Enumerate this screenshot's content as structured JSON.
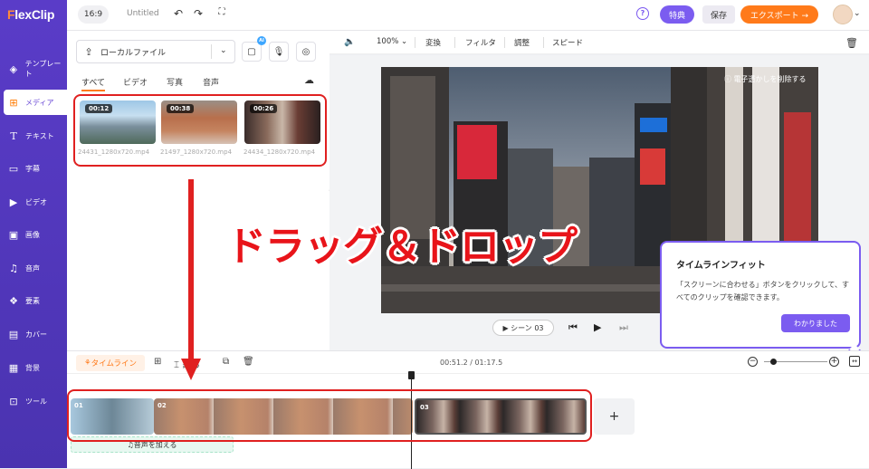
{
  "app": {
    "logo": "FlexClip",
    "doc_title": "Untitled",
    "ratio": "16:9"
  },
  "topbar": {
    "special_label": "特典",
    "save_label": "保存",
    "export_label": "エクスポート →"
  },
  "sidebar": {
    "items": [
      {
        "label": "テンプレート",
        "icon": "layers-icon"
      },
      {
        "label": "メディア",
        "icon": "media-icon"
      },
      {
        "label": "テキスト",
        "icon": "text-icon"
      },
      {
        "label": "字幕",
        "icon": "subtitle-icon"
      },
      {
        "label": "ビデオ",
        "icon": "video-icon"
      },
      {
        "label": "画像",
        "icon": "image-icon"
      },
      {
        "label": "音声",
        "icon": "music-icon"
      },
      {
        "label": "要素",
        "icon": "elements-icon"
      },
      {
        "label": "カバー",
        "icon": "cover-icon"
      },
      {
        "label": "背景",
        "icon": "background-icon"
      },
      {
        "label": "ツール",
        "icon": "tools-icon"
      }
    ],
    "active_index": 1
  },
  "media": {
    "local_file_label": "ローカルファイル",
    "ai_badge": "AI",
    "tabs": [
      "すべて",
      "ビデオ",
      "写真",
      "音声"
    ],
    "files": [
      {
        "duration": "00:12",
        "name": "24431_1280x720.mp4"
      },
      {
        "duration": "00:38",
        "name": "21497_1280x720.mp4"
      },
      {
        "duration": "00:26",
        "name": "24434_1280x720.mp4"
      }
    ]
  },
  "edit_toolbar": {
    "zoom": "100%",
    "items": [
      "変換",
      "フィルタ",
      "調整",
      "スピード"
    ]
  },
  "preview": {
    "watermark_label": "ⓘ 電子透かしを削除する",
    "scene_label": "▶ シーン 03"
  },
  "tooltip": {
    "title": "タイムラインフィット",
    "body": "「スクリーンに合わせる」ボタンをクリックして、すべてのクリップを確認できます。",
    "ok_label": "わかりました"
  },
  "timeline": {
    "button_label": "タイムライン",
    "split_label": "割る",
    "time": "00:51.2 / 01:17.5",
    "clips": [
      "01",
      "02",
      "03"
    ],
    "add_label": "+",
    "audio_label": "音声を加える"
  },
  "annotation": {
    "drag_drop": "ドラッグ＆ドロップ"
  },
  "colors": {
    "brand_purple": "#5a3cc8",
    "accent_orange": "#ff7a1a",
    "annotation_red": "#e02020"
  }
}
